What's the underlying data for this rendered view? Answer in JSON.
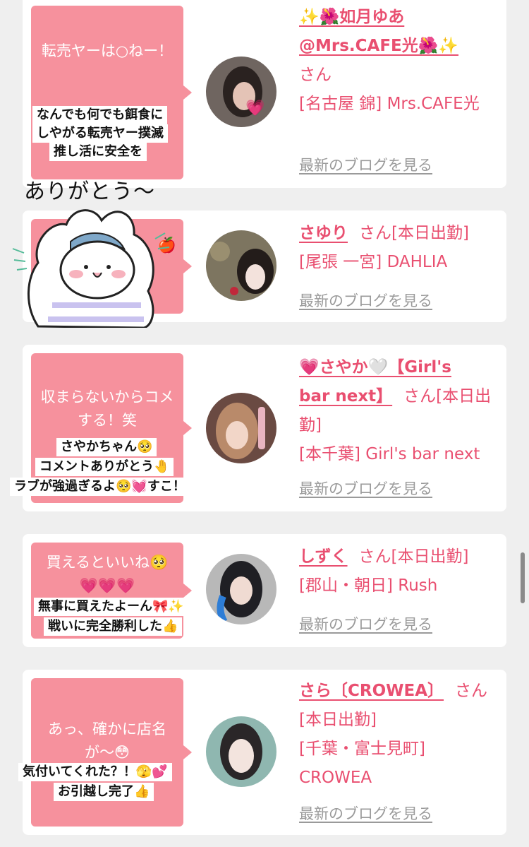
{
  "cards": [
    {
      "bubble_text": "転売ヤーは○ねー！",
      "sticker_lines": [
        "なんでも何でも餌食に",
        "しやがる転売ヤー撲滅",
        "推し活に安全を"
      ],
      "name_line1": "✨🌺如月ゆあ",
      "name_line2": "@Mrs.CAFE光🌺✨",
      "suffix": "さん",
      "shop": "[名古屋 錦] Mrs.CAFE光",
      "blog_link": "最新のブログを見る"
    },
    {
      "bubble_text": "🍎",
      "handwritten": "ありがとう〜",
      "name": "さゆり",
      "suffix": "さん[本日出勤]",
      "shop": "[尾張 一宮] DAHLIA",
      "blog_link": "最新のブログを見る"
    },
    {
      "bubble_text": "収まらないからコメする！笑",
      "sticker_lines": [
        "さやかちゃん🥺",
        "コメントありがとう🤚",
        "ラブが強過ぎるよ🥺💓すこ！"
      ],
      "name_line1": "💗さやか🤍【Girl's",
      "name_line2": "bar next】",
      "suffix": "さん[本日出勤]",
      "shop": "[本千葉] Girl's bar next",
      "blog_link": "最新のブログを見る"
    },
    {
      "bubble_text": "買えるといいね🥺💗💗💗",
      "sticker_lines": [
        "無事に買えたよーん🎀✨",
        "戦いに完全勝利した👍"
      ],
      "name": "しずく",
      "suffix": "さん[本日出勤]",
      "shop": "[郡山・朝日] Rush",
      "blog_link": "最新のブログを見る"
    },
    {
      "bubble_text": "あっ、確かに店名が〜😳",
      "sticker_lines": [
        "気付いてくれた？！🫣💕",
        "お引越し完了👍"
      ],
      "name": "さら〔CROWEA〕",
      "suffix": "さん[本日出勤]",
      "shop": "[千葉・富士見町] CROWEA",
      "blog_link": "最新のブログを見る"
    }
  ],
  "colors": {
    "accent": "#e94f70",
    "bubble": "#f6919d",
    "link_gray": "#9a9a9a",
    "background": "#efefef"
  }
}
